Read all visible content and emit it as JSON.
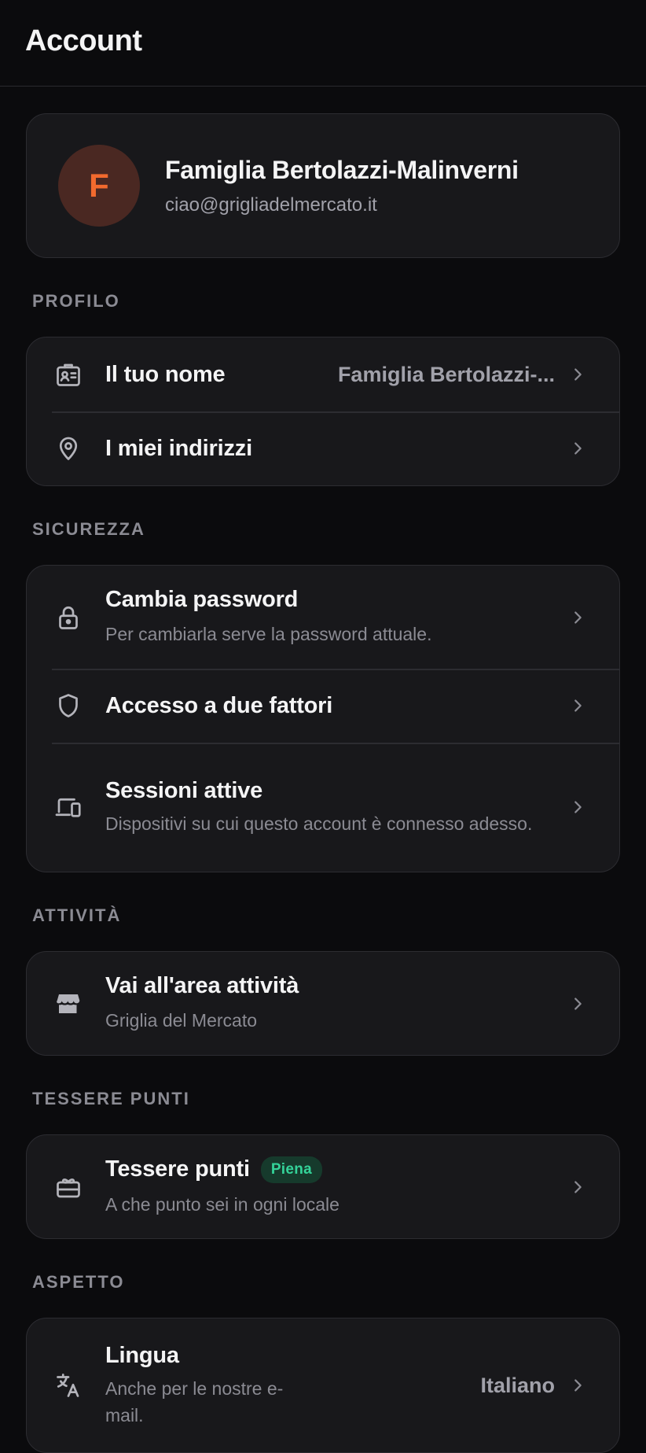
{
  "header": {
    "title": "Account"
  },
  "profile": {
    "initial": "F",
    "name": "Famiglia Bertolazzi-Malinverni",
    "email": "ciao@grigliadelmercato.it"
  },
  "sections": {
    "profilo": {
      "label": "PROFILO",
      "name_row": {
        "title": "Il tuo nome",
        "value": "Famiglia Bertolazzi-..."
      },
      "address_row": {
        "title": "I miei indirizzi"
      }
    },
    "sicurezza": {
      "label": "SICUREZZA",
      "password_row": {
        "title": "Cambia password",
        "subtitle": "Per cambiarla serve la password attuale."
      },
      "twofa_row": {
        "title": "Accesso a due fattori"
      },
      "sessions_row": {
        "title": "Sessioni attive",
        "subtitle": "Dispositivi su cui questo account è connesso adesso."
      }
    },
    "attivita": {
      "label": "ATTIVITÀ",
      "business_row": {
        "title": "Vai all'area attività",
        "subtitle": "Griglia del Mercato"
      }
    },
    "tessere": {
      "label": "TESSERE PUNTI",
      "cards_row": {
        "title": "Tessere punti",
        "badge": "Piena",
        "subtitle": "A che punto sei in ogni locale"
      }
    },
    "aspetto": {
      "label": "ASPETTO",
      "language_row": {
        "title": "Lingua",
        "subtitle": "Anche per le nostre e-mail.",
        "value": "Italiano"
      }
    }
  },
  "colors": {
    "background": "#0b0b0d",
    "card": "#18181b",
    "accent": "#f26a2e",
    "badge_green": "#34d399"
  },
  "icons": {
    "name_row": "id-badge-icon",
    "address_row": "map-pin-icon",
    "password_row": "lock-icon",
    "twofa_row": "shield-icon",
    "sessions_row": "devices-icon",
    "business_row": "store-icon",
    "cards_row": "gift-card-icon",
    "language_row": "translate-icon",
    "chevron": "chevron-right-icon"
  }
}
